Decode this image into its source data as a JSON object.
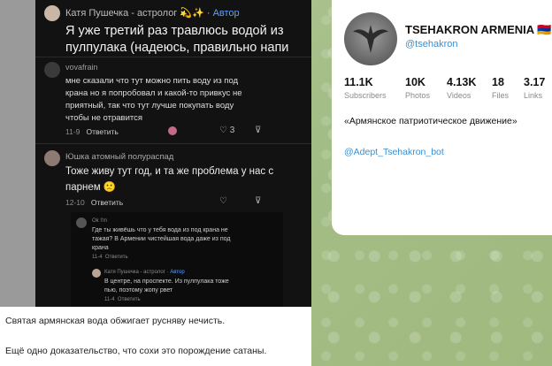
{
  "post": {
    "msg1": {
      "username": "Катя Пушечка - астролог",
      "emoji": "💫✨",
      "author_label": "Автор",
      "line1": "Я уже третий раз травлюсь водой из",
      "line2": "пулпулака (надеюсь, правильно напи"
    },
    "msg2": {
      "username": "vovafrain",
      "line1": "мне сказали что тут можно пить воду из под",
      "line2": "крана но я попробовал и какой-то привкус не",
      "line3": "приятный, так что тут лучше покупать воду",
      "line4": "чтобы не отравится",
      "time": "11-9",
      "reply": "Ответить",
      "likes": "3"
    },
    "msg3": {
      "username": "Юшка атомный полураспад",
      "line1": "Тоже живу тут год, и та же проблема у нас с",
      "line2": "парнем 🙁",
      "time": "12-10",
      "reply": "Ответить"
    },
    "msg4": {
      "username": "Ok I'm",
      "line1": "Где ты живёшь что у тебя вода из под крана не",
      "line2": "тажая? В Армении чистейшая вода даже из под",
      "line3": "крана",
      "time": "11-4",
      "reply": "Ответить"
    },
    "msg5": {
      "username": "Катя Пушечка - астролог",
      "author_label": "Автор",
      "line1": "В центре, на проспекте. Из пулпулака тоже",
      "line2": "пью, поэтому жопу рвет",
      "time": "11-4",
      "reply": "Ответить"
    },
    "caption1": "Святая армянская вода обжигает русняву нечисть.",
    "caption2": "Ещё одно доказательство, что сохи это порождение сатаны."
  },
  "channel": {
    "name": "TSEHAKRON ARMENIA",
    "flag": "🇦🇲",
    "handle": "@tsehakron",
    "stats": [
      {
        "value": "11.1K",
        "label": "Subscribers"
      },
      {
        "value": "10K",
        "label": "Photos"
      },
      {
        "value": "4.13K",
        "label": "Videos"
      },
      {
        "value": "18",
        "label": "Files"
      },
      {
        "value": "3.17",
        "label": "Links"
      }
    ],
    "description": "«Армянское патриотическое движение»",
    "bot_link": "@Adept_Tsehakron_bot"
  },
  "colors": {
    "accent": "#3a8fd0",
    "author": "#5aa0ff",
    "chat_bg": "#a9c08f",
    "dark_bg": "#121212"
  }
}
